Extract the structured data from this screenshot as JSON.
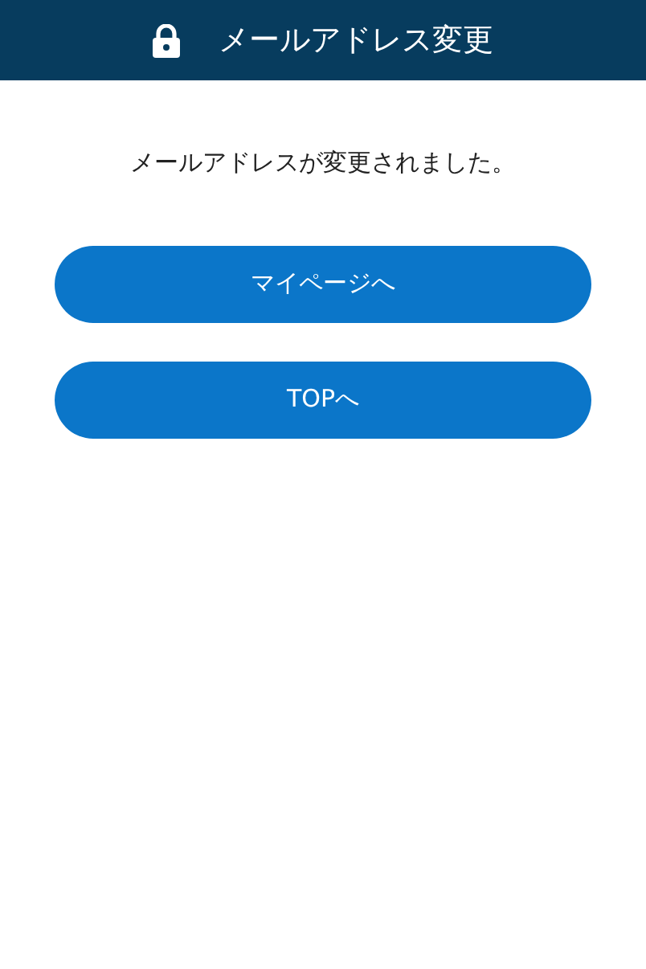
{
  "header": {
    "title": "メールアドレス変更"
  },
  "message": "メールアドレスが変更されました。",
  "buttons": [
    {
      "label": "マイページへ"
    },
    {
      "label": "TOPへ"
    }
  ]
}
